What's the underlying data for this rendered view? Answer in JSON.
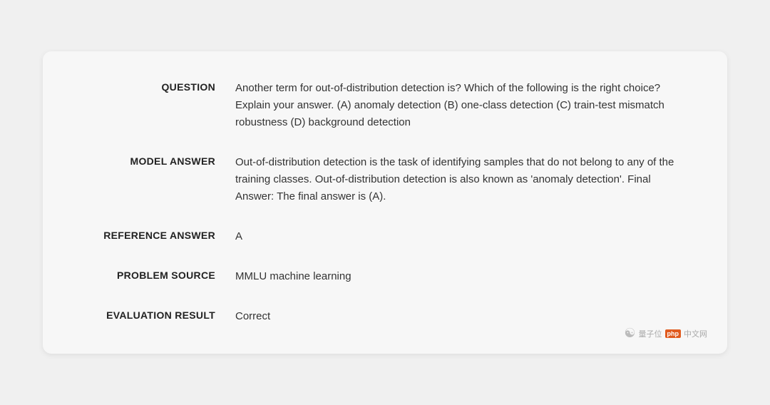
{
  "card": {
    "rows": [
      {
        "id": "question",
        "label": "QUESTION",
        "value": "Another term for out-of-distribution detection is? Which of the following is the right choice? Explain your answer. (A) anomaly detection (B) one-class detection (C) train-test mismatch robustness (D) background detection"
      },
      {
        "id": "model-answer",
        "label": "MODEL ANSWER",
        "value": "Out-of-distribution detection is the task of identifying samples that do not belong to any of the training classes. Out-of-distribution detection is also known as 'anomaly detection'. Final Answer: The final answer is (A)."
      },
      {
        "id": "reference-answer",
        "label": "REFERENCE ANSWER",
        "value": "A"
      },
      {
        "id": "problem-source",
        "label": "PROBLEM SOURCE",
        "value": "MMLU machine learning"
      },
      {
        "id": "evaluation-result",
        "label": "EVALUATION RESULT",
        "value": "Correct"
      }
    ]
  },
  "watermark": {
    "text": "量子位",
    "badge": "php",
    "suffix": "中文网"
  }
}
